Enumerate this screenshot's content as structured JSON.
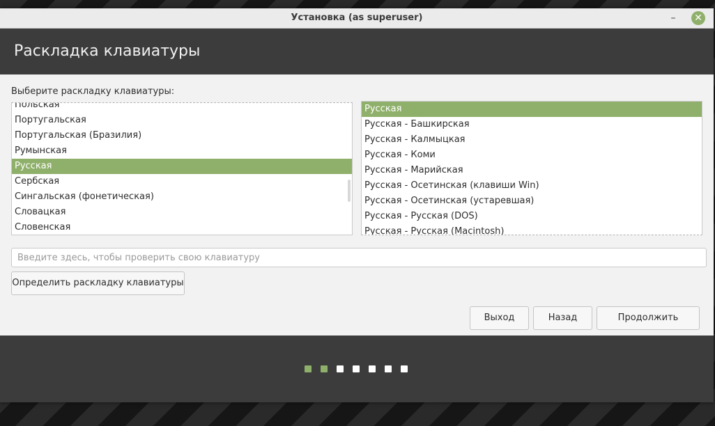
{
  "window": {
    "title": "Установка (as superuser)",
    "minimize_symbol": "–",
    "close_symbol": "✕"
  },
  "header": {
    "title": "Раскладка клавиатуры"
  },
  "main": {
    "prompt": "Выберите раскладку клавиатуры:",
    "layouts": [
      {
        "label": "Польская",
        "selected": false
      },
      {
        "label": "Португальская",
        "selected": false
      },
      {
        "label": "Португальская (Бразилия)",
        "selected": false
      },
      {
        "label": "Румынская",
        "selected": false
      },
      {
        "label": "Русская",
        "selected": true
      },
      {
        "label": "Сербская",
        "selected": false
      },
      {
        "label": "Сингальская (фонетическая)",
        "selected": false
      },
      {
        "label": "Словацкая",
        "selected": false
      },
      {
        "label": "Словенская",
        "selected": false
      }
    ],
    "variants": [
      {
        "label": "Русская",
        "selected": true
      },
      {
        "label": "Русская - Башкирская",
        "selected": false
      },
      {
        "label": "Русская - Калмыцкая",
        "selected": false
      },
      {
        "label": "Русская - Коми",
        "selected": false
      },
      {
        "label": "Русская - Марийская",
        "selected": false
      },
      {
        "label": "Русская - Осетинская (клавиши Win)",
        "selected": false
      },
      {
        "label": "Русская - Осетинская (устаревшая)",
        "selected": false
      },
      {
        "label": "Русская - Русская (DOS)",
        "selected": false
      },
      {
        "label": "Русская - Русская (Macintosh)",
        "selected": false
      }
    ],
    "test_input": {
      "placeholder": "Введите здесь, чтобы проверить свою клавиатуру",
      "value": ""
    },
    "detect_button": "Определить раскладку клавиатуры"
  },
  "actions": {
    "quit": "Выход",
    "back": "Назад",
    "continue": "Продолжить"
  },
  "progress": {
    "total_steps": 7,
    "completed_steps": 2
  },
  "colors": {
    "accent": "#8fb06a",
    "header_bg": "#3c3c3c",
    "content_bg": "#f2f2f2"
  }
}
